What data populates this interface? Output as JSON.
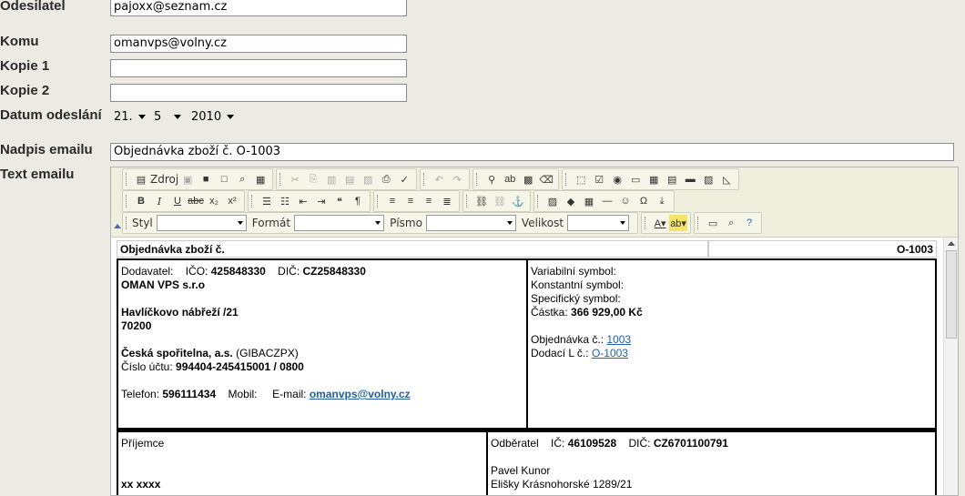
{
  "form": {
    "sender_label": "Odesilatel",
    "sender_value": "pajoxx@seznam.cz",
    "to_label": "Komu",
    "to_value": "omanvps@volny.cz",
    "cc1_label": "Kopie 1",
    "cc1_value": "",
    "cc2_label": "Kopie 2",
    "cc2_value": "",
    "date_label": "Datum odeslání",
    "date_day": "21.",
    "date_month": "5",
    "date_year": "2010",
    "subject_label": "Nadpis emailu",
    "subject_value": "Objednávka zboží č. O-1003",
    "body_label": "Text emailu"
  },
  "toolbar": {
    "source_label": "Zdroj",
    "style_label": "Styl",
    "format_label": "Formát",
    "font_label": "Písmo",
    "size_label": "Velikost"
  },
  "doc": {
    "title": "Objednávka zboží č.",
    "number": "O-1003",
    "supplier_label": "Dodavatel:",
    "ico_label": "IČO:",
    "ico_value": "425848330",
    "dic_label": "DIČ:",
    "dic_value": "CZ25848330",
    "company": "OMAN VPS s.r.o",
    "street": "Havlíčkovo nábřeží /21",
    "zip": "70200",
    "bank": "Česká spořitelna, a.s.",
    "bank_code": "(GIBACZPX)",
    "account_label": "Číslo účtu:",
    "account_value": "994404-245415001 / 0800",
    "phone_label": "Telefon:",
    "phone_value": "596111434",
    "mobile_label": "Mobil:",
    "email_label": "E-mail:",
    "email_value": "omanvps@volny.cz",
    "vs_label": "Variabilní symbol:",
    "ks_label": "Konstantní symbol:",
    "ss_label": "Specifický symbol:",
    "amount_label": "Částka:",
    "amount_value": "366 929,00 Kč",
    "order_label": "Objednávka č.:",
    "order_value": "1003",
    "delivery_label": "Dodací L č.:",
    "delivery_value": "O-1003",
    "recipient_label": "Příjemce",
    "recipient_name": "xx xxxx",
    "customer_label": "Odběratel",
    "customer_ic_label": "IČ:",
    "customer_ic_value": "46109528",
    "customer_dic_label": "DIČ:",
    "customer_dic_value": "CZ6701100791",
    "customer_name": "Pavel Kunor",
    "customer_street": "Elišky Krásnohorské 1289/21"
  }
}
